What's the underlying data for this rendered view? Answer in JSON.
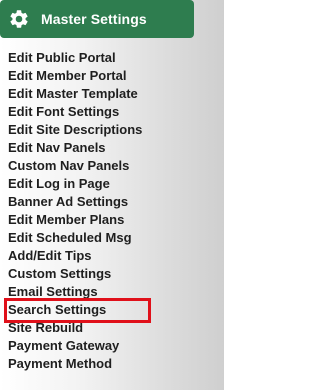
{
  "header": {
    "title": "Master Settings",
    "icon": "gear-icon",
    "bg_color": "#2e7d4f"
  },
  "menu": {
    "items": [
      {
        "label": "Edit Public Portal"
      },
      {
        "label": "Edit Member Portal"
      },
      {
        "label": "Edit Master Template"
      },
      {
        "label": "Edit Font Settings"
      },
      {
        "label": "Edit Site Descriptions"
      },
      {
        "label": "Edit Nav Panels"
      },
      {
        "label": "Custom Nav Panels"
      },
      {
        "label": "Edit Log in Page"
      },
      {
        "label": "Banner Ad Settings"
      },
      {
        "label": "Edit Member Plans"
      },
      {
        "label": "Edit Scheduled Msg"
      },
      {
        "label": "Add/Edit Tips"
      },
      {
        "label": "Custom Settings"
      },
      {
        "label": "Email Settings"
      },
      {
        "label": "Search Settings",
        "highlighted": true,
        "highlight_color": "#e0101a"
      },
      {
        "label": "Site Rebuild"
      },
      {
        "label": "Payment Gateway"
      },
      {
        "label": "Payment Method"
      }
    ]
  }
}
